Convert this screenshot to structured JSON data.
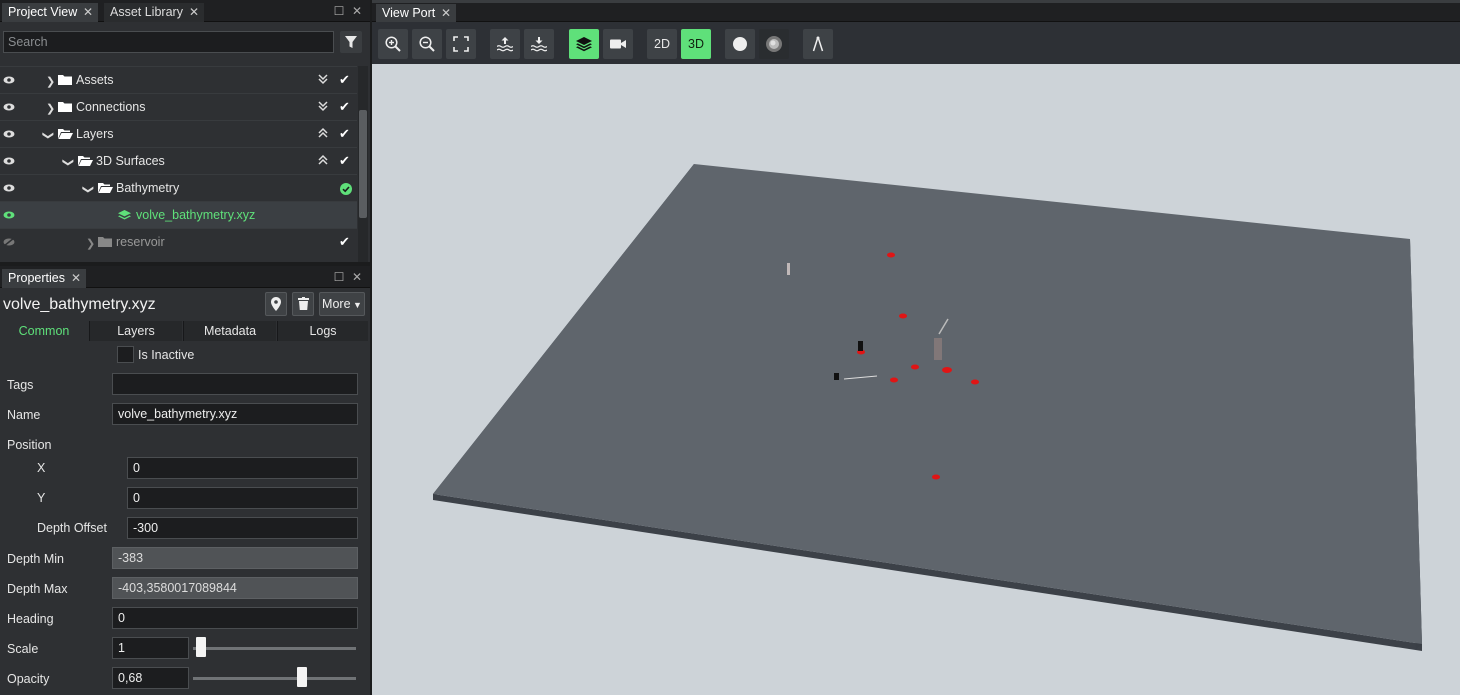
{
  "project_panel": {
    "tabs": [
      {
        "label": "Project View"
      },
      {
        "label": "Asset Library"
      }
    ],
    "search": {
      "placeholder": "Search",
      "value": ""
    },
    "tree": [
      {
        "label": "Assets",
        "status": "check",
        "arrows": "expand"
      },
      {
        "label": "Connections",
        "status": "check",
        "arrows": "expand"
      },
      {
        "label": "Layers",
        "status": "check",
        "arrows": "collapse"
      },
      {
        "label": "3D Surfaces",
        "status": "check",
        "arrows": "collapse"
      },
      {
        "label": "Bathymetry",
        "status": "check-circle"
      },
      {
        "label": "volve_bathymetry.xyz",
        "status": "none",
        "selected": true
      },
      {
        "label": "reservoir",
        "status": "check",
        "hidden": true
      }
    ]
  },
  "properties_panel": {
    "tab": "Properties",
    "title": "volve_bathymetry.xyz",
    "more_label": "More",
    "subtabs": [
      {
        "label": "Common"
      },
      {
        "label": "Layers"
      },
      {
        "label": "Metadata"
      },
      {
        "label": "Logs"
      }
    ],
    "is_inactive_label": "Is Inactive",
    "is_inactive": false,
    "fields": {
      "tags": {
        "label": "Tags",
        "value": ""
      },
      "name": {
        "label": "Name",
        "value": "volve_bathymetry.xyz"
      },
      "position_label": "Position",
      "x": {
        "label": "X",
        "value": "0"
      },
      "y": {
        "label": "Y",
        "value": "0"
      },
      "depth_offset": {
        "label": "Depth Offset",
        "value": "-300"
      },
      "depth_min": {
        "label": "Depth Min",
        "value": "-383"
      },
      "depth_max": {
        "label": "Depth Max",
        "value": "-403,3580017089844"
      },
      "heading": {
        "label": "Heading",
        "value": "0"
      },
      "scale": {
        "label": "Scale",
        "value": "1",
        "slider_fraction": 0.02
      },
      "opacity": {
        "label": "Opacity",
        "value": "0,68",
        "slider_fraction": 0.68
      }
    }
  },
  "viewport": {
    "tab": "View Port",
    "toolbar": {
      "mode_2d": "2D",
      "mode_3d": "3D",
      "active_mode": "3D",
      "layers_active": true
    },
    "colors": {
      "accent": "#5fe07a",
      "surface": "#5f656c",
      "background": "#cdd3d8",
      "marker": "#e01515"
    }
  }
}
